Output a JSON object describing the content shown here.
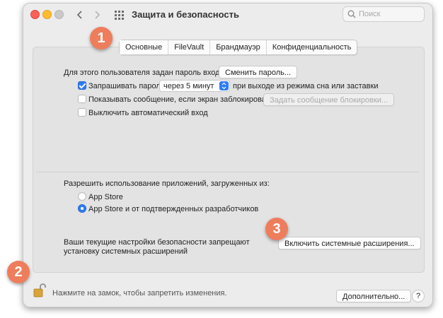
{
  "window": {
    "title": "Защита и безопасность"
  },
  "search": {
    "placeholder": "Поиск"
  },
  "tabs": [
    {
      "label": "Основные",
      "active": true
    },
    {
      "label": "FileVault",
      "active": false
    },
    {
      "label": "Брандмауэр",
      "active": false
    },
    {
      "label": "Конфиденциальность",
      "active": false
    }
  ],
  "general": {
    "password_text": "Для этого пользователя задан пароль входа",
    "change_password_button": "Сменить пароль...",
    "require_password": {
      "label": "Запрашивать пароль",
      "checked": true,
      "select_value": "через 5 минут",
      "suffix": "при выходе из режима сна или заставки"
    },
    "show_message": {
      "label": "Показывать сообщение, если экран заблокирован",
      "checked": false,
      "button": "Задать сообщение блокировки..."
    },
    "disable_autologin": {
      "label": "Выключить автоматический вход",
      "checked": false
    }
  },
  "downloads": {
    "heading": "Разрешить использование приложений, загруженных из:",
    "options": [
      {
        "label": "App Store",
        "selected": false
      },
      {
        "label": "App Store и от подтвержденных разработчиков",
        "selected": true
      }
    ]
  },
  "extensions": {
    "text_line1": "Ваши текущие настройки безопасности запрещают",
    "text_line2": "установку системных расширений",
    "button": "Включить системные расширения..."
  },
  "footer": {
    "lock_text": "Нажмите на замок, чтобы запретить изменения.",
    "advanced_button": "Дополнительно...",
    "help_button": "?"
  },
  "callouts": [
    "1",
    "2",
    "3"
  ],
  "colors": {
    "accent": "#2e7cf6",
    "callout": "#ee7d5c"
  }
}
